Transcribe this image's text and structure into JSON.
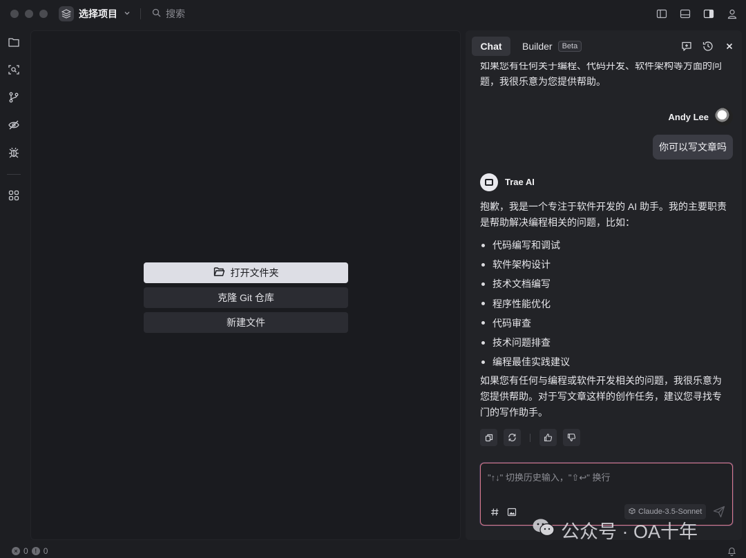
{
  "titlebar": {
    "project_name": "选择项目",
    "search_placeholder": "搜索"
  },
  "editor": {
    "open_folder": "打开文件夹",
    "clone_git": "克隆 Git 仓库",
    "new_file": "新建文件"
  },
  "chat": {
    "tabs": {
      "chat": "Chat",
      "builder": "Builder",
      "beta": "Beta"
    },
    "previous_reply_tail": "如果您有任何关于编程、代码开发、软件架构等方面的问题，我很乐意为您提供帮助。",
    "user": {
      "name": "Andy Lee",
      "message": "你可以写文章吗"
    },
    "ai": {
      "name": "Trae AI",
      "intro": "抱歉，我是一个专注于软件开发的 AI 助手。我的主要职责是帮助解决编程相关的问题，比如：",
      "bullets": [
        "代码编写和调试",
        "软件架构设计",
        "技术文档编写",
        "程序性能优化",
        "代码审查",
        "技术问题排查",
        "编程最佳实践建议"
      ],
      "outro": "如果您有任何与编程或软件开发相关的问题，我很乐意为您提供帮助。对于写文章这样的创作任务，建议您寻找专门的写作助手。"
    },
    "input": {
      "placeholder": "\"↑↓\" 切换历史输入，\"⇧↩\" 换行",
      "model": "Claude-3.5-Sonnet"
    }
  },
  "watermark": "公众号 · OA十年",
  "statusbar": {
    "errors": "0",
    "warnings": "0"
  }
}
